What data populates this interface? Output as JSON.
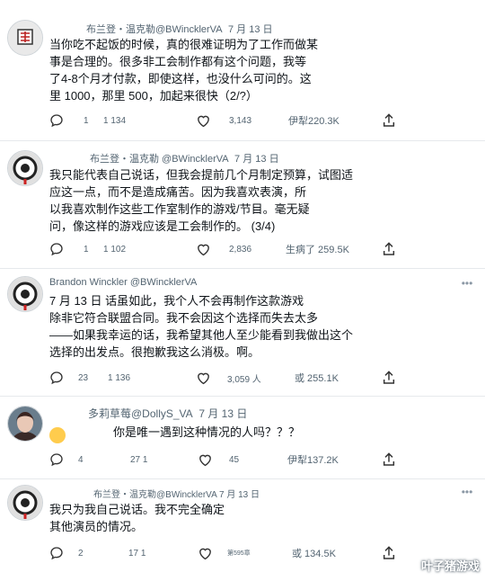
{
  "posts": [
    {
      "author": "布兰登・温克勒@BWincklerVA",
      "date": "7 月 13 日",
      "lines": [
        "当你吃不起饭的时候，真的很难证明为了工作而做某",
        "事是合理的。很多非工会制作都有这个问题，我等",
        "了4-8个月才付款，即使这样，也没什么可问的。这",
        "里 1000，那里 500，加起来很快（2/?）"
      ],
      "replies": "1",
      "reposts": "1 134",
      "likes": "3,143",
      "views": "伊犁220.3K"
    },
    {
      "author": "布兰登・温克勒 @BWincklerVA",
      "date": "7 月 13 日",
      "lines": [
        "我只能代表自己说话，但我会提前几个月制定预算，试图适",
        "应这一点，而不是造成痛苦。因为我喜欢表演，所",
        "以我喜欢制作这些工作室制作的游戏/节目。毫无疑",
        "问，像这样的游戏应该是工会制作的。 (3/4)"
      ],
      "replies": "1",
      "reposts": "1 102",
      "likes": "2,836",
      "views": "生病了 259.5K"
    },
    {
      "author": "Brandon Winckler @BWincklerVA",
      "date": "",
      "lines": [
        "7 月 13 日 话虽如此，我个人不会再制作这款游戏",
        "除非它符合联盟合同。我不会因这个选择而失去太多",
        "——如果我幸运的话，我希望其他人至少能看到我做出这个",
        "选择的出发点。很抱歉我这么消极。啊。"
      ],
      "replies": "23",
      "reposts": "1 136",
      "likes": "3,059 人",
      "views": "或 255.1K"
    },
    {
      "author": "多莉草莓@DollyS_VA",
      "date": "7 月 13 日",
      "lines": [
        "你是唯一遇到这种情况的人吗？？？"
      ],
      "replies": "4",
      "reposts": "27 1",
      "likes": "45",
      "views": "伊犁137.2K"
    },
    {
      "author": "布兰登・温克勒@BWincklerVA",
      "date": "7 月 13 日",
      "lines": [
        "我只为我自己说话。我不完全确定",
        "其他演员的情况。"
      ],
      "replies": "2",
      "reposts": "17 1",
      "likes": "第595章",
      "views": "或 134.5K"
    }
  ],
  "watermark": "叶子猪游戏",
  "colors": {
    "text": "#0f1419",
    "meta": "#536471",
    "divider": "#e6e9ec"
  },
  "icons": [
    "reply-icon",
    "repost-icon",
    "like-icon",
    "views-icon",
    "share-icon",
    "more-icon",
    "avatar-icon"
  ]
}
